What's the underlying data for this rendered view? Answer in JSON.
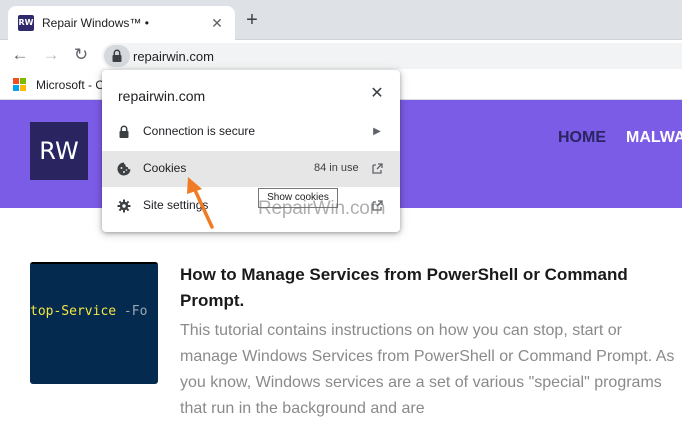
{
  "browser": {
    "tab_title": "Repair Windows™ •",
    "tab_favicon": "RW",
    "tab_close_icon": "✕",
    "new_tab_icon": "+",
    "back_icon": "←",
    "forward_icon": "→",
    "reload_icon": "↻",
    "url": "repairwin.com",
    "bookmark_label": "Microsoft - O"
  },
  "popup": {
    "domain": "repairwin.com",
    "close_icon": "✕",
    "rows": [
      {
        "label": "Connection is secure",
        "icon": "lock-icon",
        "trail": "▶"
      },
      {
        "label": "Cookies",
        "icon": "cookie-icon",
        "meta": "84 in use",
        "trail": "open-in-new-icon"
      },
      {
        "label": "Site settings",
        "icon": "gear-icon",
        "trail": "open-in-new-icon"
      }
    ],
    "tooltip": "Show cookies"
  },
  "site": {
    "logo_text": "RW",
    "nav": [
      {
        "label": "HOME",
        "color": "#2a2561"
      },
      {
        "label": "MALWA",
        "color": "#ffffff"
      }
    ],
    "header_color": "#7b5ce6"
  },
  "article": {
    "thumb_code_cmd": "top-Service",
    "thumb_code_param": " -Fo",
    "title": "How to Manage Services from PowerShell or Command Prompt.",
    "body": "This tutorial contains instructions on how you can stop, start or manage Windows Services from PowerShell or Command Prompt. As you know, Windows services are a set of various \"special\" programs that run in the background and are"
  },
  "watermark": "RepairWin.com",
  "colors": {
    "accent_arrow": "#f07b24",
    "microsoft": [
      "#f25022",
      "#7fba00",
      "#00a4ef",
      "#ffb900"
    ]
  }
}
